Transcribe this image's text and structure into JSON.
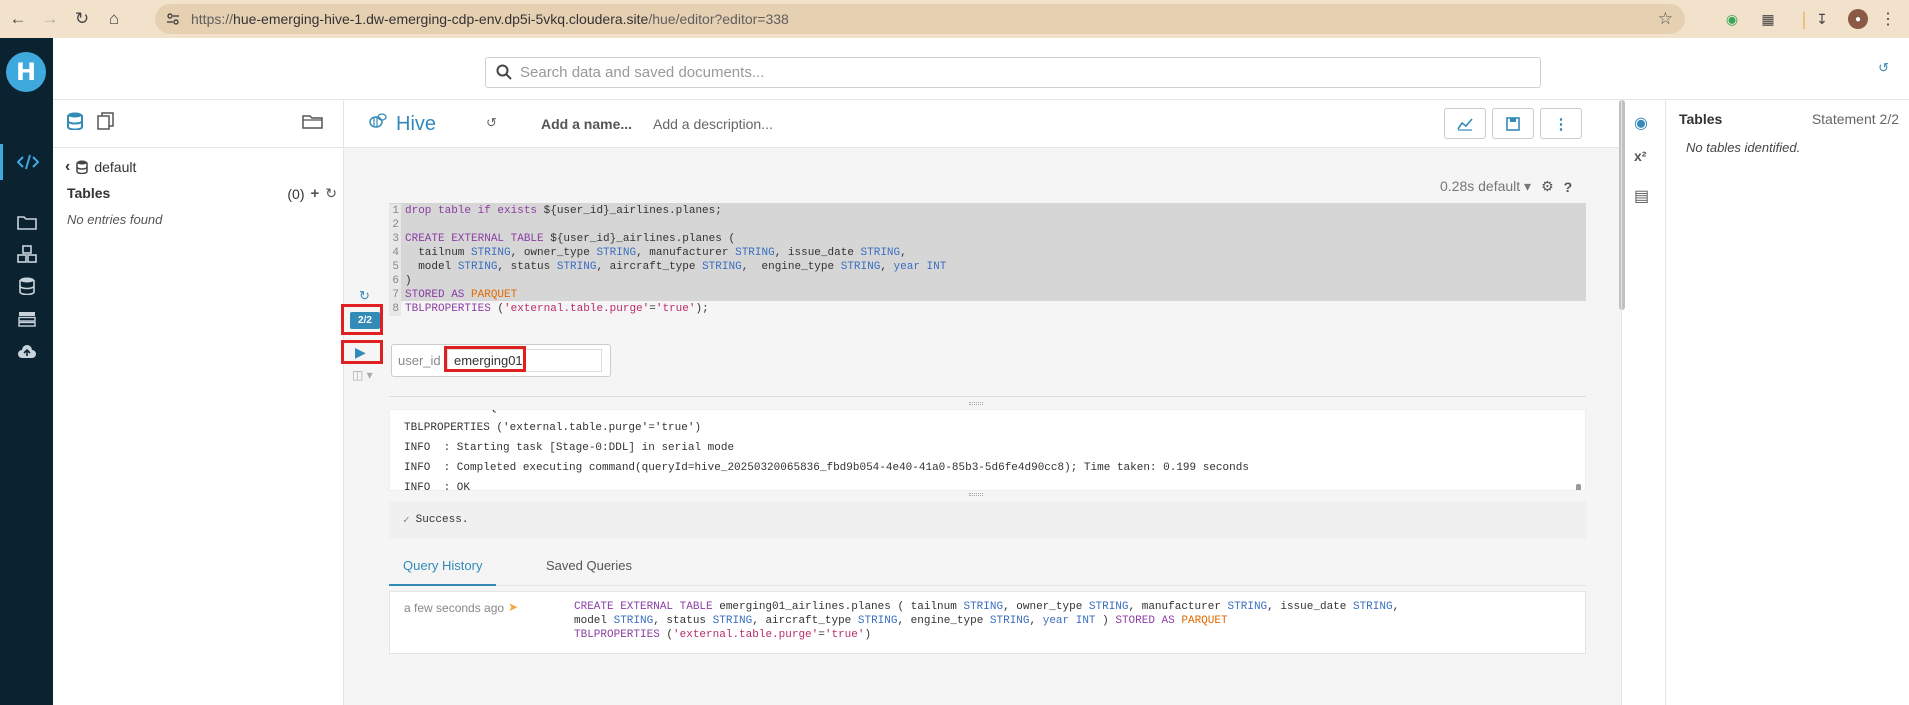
{
  "browser": {
    "url_prefix": "https://",
    "url_host": "hue-emerging-hive-1.dw-emerging-cdp-env.dp5i-5vkq.cloudera.site",
    "url_path": "/hue/editor?editor=338"
  },
  "topbar": {
    "search_placeholder": "Search data and saved documents..."
  },
  "assist": {
    "database": "default",
    "tables_label": "Tables",
    "tables_count": "(0)",
    "empty_text": "No entries found"
  },
  "editor": {
    "dialect": "Hive",
    "name_placeholder": "Add a name...",
    "description_placeholder": "Add a description...",
    "execution_meta": "0.28s default",
    "statement_badge": "2/2",
    "variable_label": "user_id",
    "variable_value": "emerging01",
    "code_lines": [
      {
        "n": "1"
      },
      {
        "n": "2"
      },
      {
        "n": "3"
      },
      {
        "n": "4"
      },
      {
        "n": "5"
      },
      {
        "n": "6"
      },
      {
        "n": "7"
      },
      {
        "n": "8"
      }
    ],
    "log_lines": [
      "STORED AS PARQUET",
      "TBLPROPERTIES ('external.table.purge'='true')",
      "INFO  : Starting task [Stage-0:DDL] in serial mode",
      "INFO  : Completed executing command(queryId=hive_20250320065836_fbd9b054-4e40-41a0-85b3-5d6fe4d90cc8); Time taken: 0.199 seconds",
      "INFO  : OK"
    ],
    "success_text": "Success.",
    "tabs": [
      "Query History",
      "Saved Queries"
    ],
    "history": {
      "time": "a few seconds ago"
    }
  },
  "right_panel": {
    "title": "Tables",
    "statement": "Statement 2/2",
    "empty_text": "No tables identified."
  },
  "colors": {
    "accent": "#338bb8",
    "sidebar": "#0b2230",
    "highlight_box": "#e02020"
  }
}
